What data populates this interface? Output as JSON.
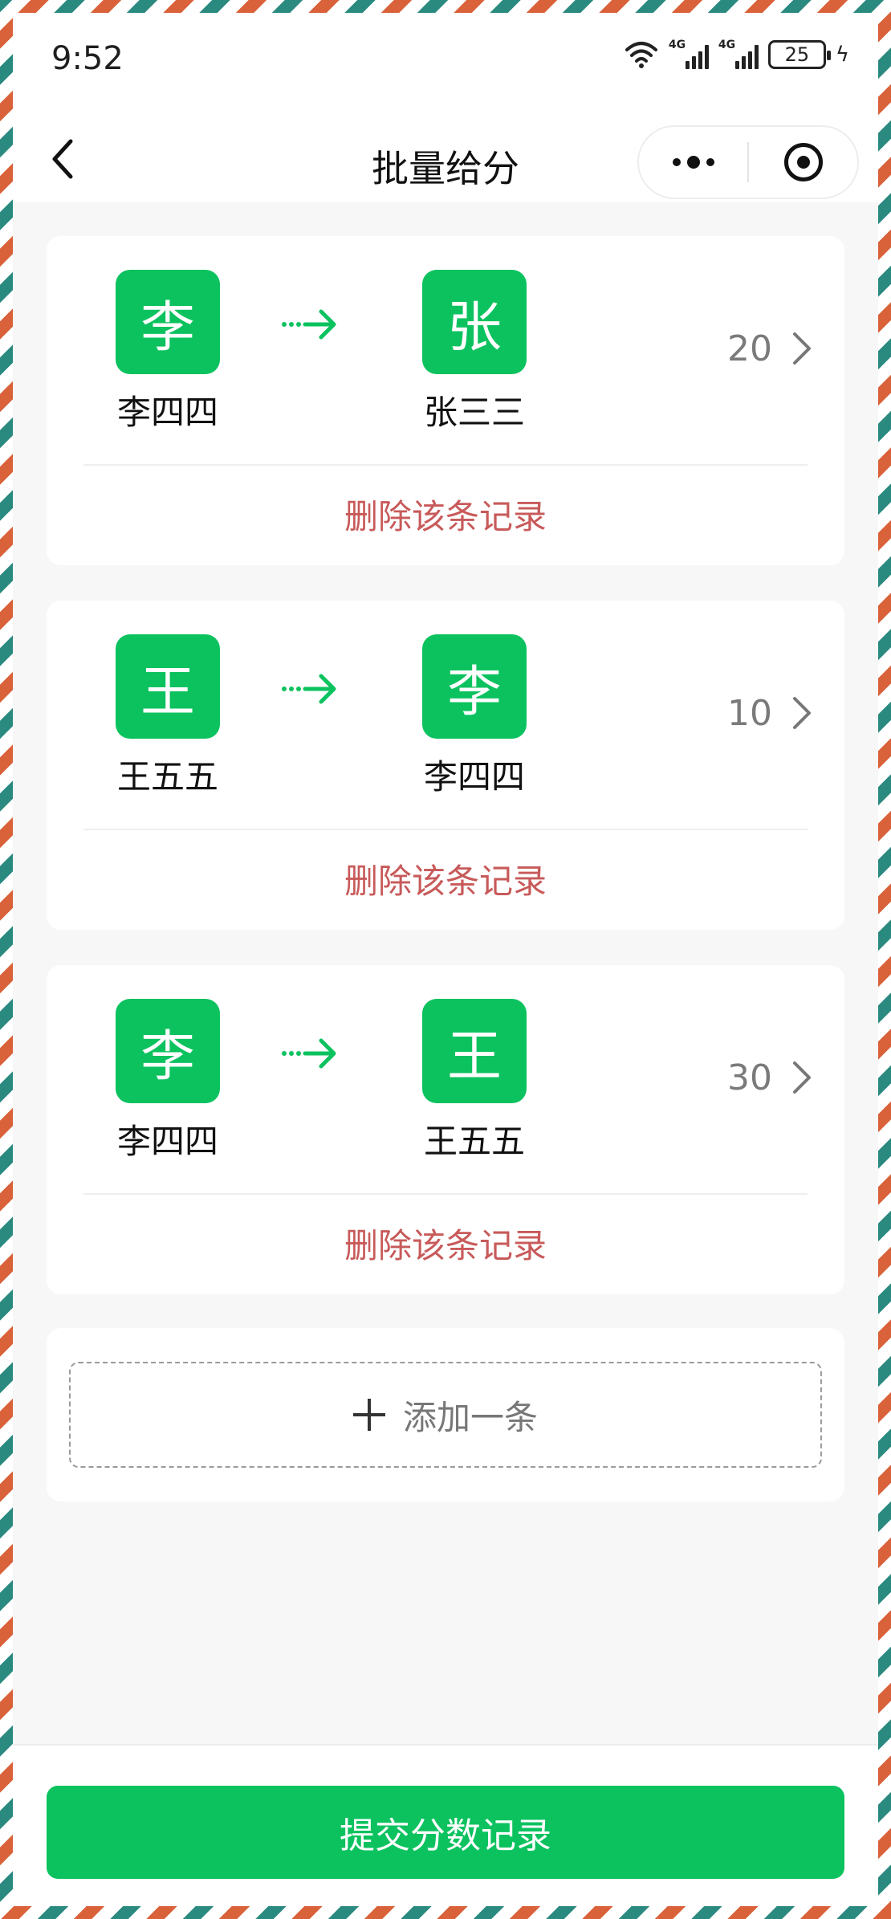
{
  "status_bar": {
    "time": "9:52",
    "network_1": "4G",
    "network_2": "4G",
    "battery": "25"
  },
  "nav": {
    "title": "批量给分"
  },
  "records": [
    {
      "from": {
        "avatar_char": "李",
        "name": "李四四"
      },
      "to": {
        "avatar_char": "张",
        "name": "张三三"
      },
      "score": "20",
      "delete_label": "删除该条记录"
    },
    {
      "from": {
        "avatar_char": "王",
        "name": "王五五"
      },
      "to": {
        "avatar_char": "李",
        "name": "李四四"
      },
      "score": "10",
      "delete_label": "删除该条记录"
    },
    {
      "from": {
        "avatar_char": "李",
        "name": "李四四"
      },
      "to": {
        "avatar_char": "王",
        "name": "王五五"
      },
      "score": "30",
      "delete_label": "删除该条记录"
    }
  ],
  "add": {
    "label": "添加一条"
  },
  "submit": {
    "label": "提交分数记录"
  },
  "colors": {
    "accent_green": "#0cc25f",
    "delete_red": "#c85a5a",
    "border_stripe_orange": "#d9623a",
    "border_stripe_teal": "#2b8a80"
  },
  "icons": [
    "wifi-icon",
    "signal-icon",
    "battery-icon",
    "charging-icon",
    "back-arrow-icon",
    "more-dots-icon",
    "target-icon",
    "transfer-arrow-icon",
    "chevron-right-icon",
    "plus-icon"
  ]
}
